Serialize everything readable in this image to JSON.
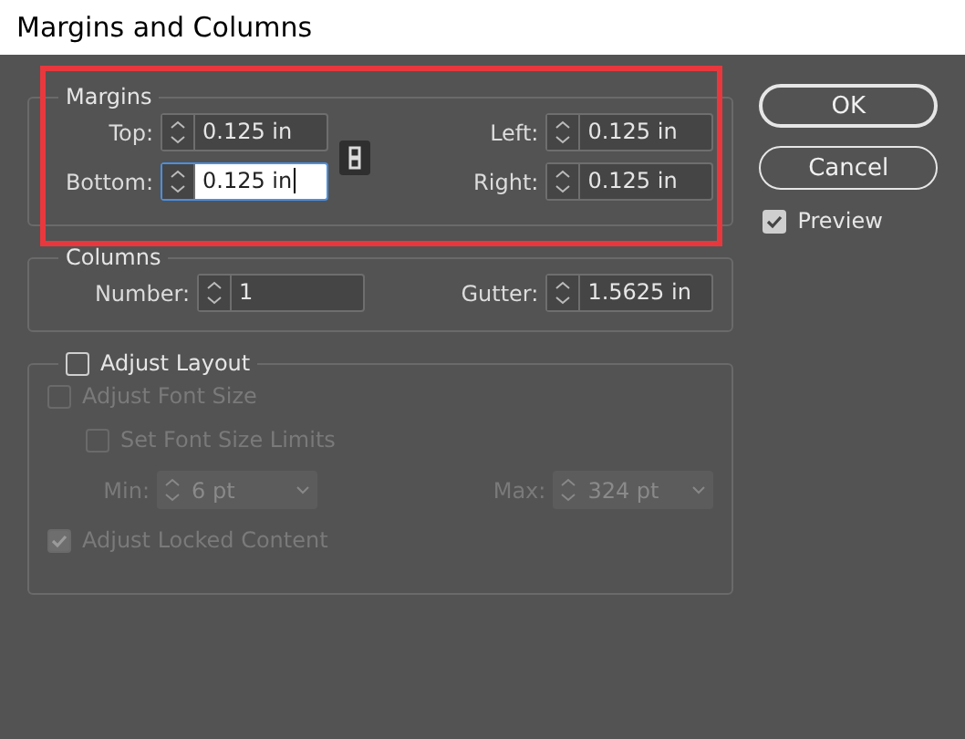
{
  "window": {
    "title": "Margins and Columns"
  },
  "margins": {
    "legend": "Margins",
    "highlighted": true,
    "fields": [
      {
        "label": "Top:",
        "value": "0.125 in",
        "focused": false
      },
      {
        "label": "Left:",
        "value": "0.125 in",
        "focused": false
      },
      {
        "label": "Bottom:",
        "value": "0.125 in",
        "focused": true
      },
      {
        "label": "Right:",
        "value": "0.125 in",
        "focused": false
      }
    ]
  },
  "columns": {
    "legend": "Columns",
    "fields": [
      {
        "label": "Number:",
        "value": "1",
        "focused": false
      },
      {
        "label": "Gutter:",
        "value": "1.5625 in",
        "focused": false
      }
    ]
  },
  "adjust_layout": {
    "label": "Adjust Layout",
    "checked": false,
    "adjust_font_size": {
      "label": "Adjust Font Size",
      "checked": false,
      "disabled": true
    },
    "set_font_size_limits": {
      "label": "Set Font Size Limits",
      "checked": false,
      "disabled": true
    },
    "limits": [
      {
        "label": "Min:",
        "value": "6 pt",
        "disabled": true
      },
      {
        "label": "Max:",
        "value": "324 pt",
        "disabled": true
      }
    ],
    "adjust_locked_content": {
      "label": "Adjust Locked Content",
      "checked": true,
      "disabled": true
    }
  },
  "buttons": [
    {
      "label": "OK",
      "default": true
    },
    {
      "label": "Cancel",
      "default": false
    }
  ],
  "preview": {
    "label": "Preview",
    "checked": true
  }
}
